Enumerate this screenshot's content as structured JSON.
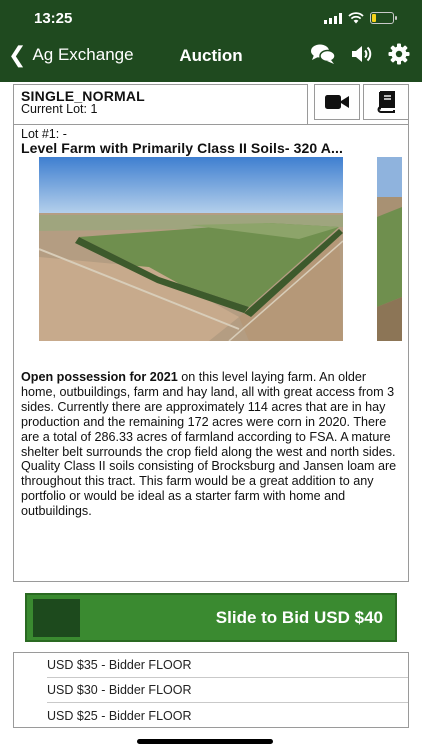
{
  "status_bar": {
    "time": "13:25"
  },
  "nav": {
    "back_label": "Ag Exchange",
    "title": "Auction",
    "icons": [
      "chat-bubbles-icon",
      "speaker-icon",
      "gear-icon"
    ],
    "color": "#1f4a1f"
  },
  "auction": {
    "type_label": "SINGLE_NORMAL",
    "current_lot": "Current Lot: 1",
    "buttons": [
      "video-camera-icon",
      "catalog-book-icon"
    ]
  },
  "lot": {
    "number": "Lot #1: -",
    "title": "Level Farm with Primarily Class II Soils- 320 A...",
    "description_lead": "Open possession for 2021",
    "description_body": " on this level laying farm. An older home, outbuildings, farm and hay land, all with great access from 3 sides. Currently there are approximately 114 acres that are in hay production and the remaining 172 acres were corn in 2020. There are a total of 286.33 acres of farmland according to FSA. A mature shelter belt surrounds the crop field along the west and north sides. Quality Class II soils consisting of Brocksburg and Jansen loam are throughout this tract. This farm would be a great addition to any portfolio or would be ideal as a starter farm with home and outbuildings."
  },
  "bid": {
    "slide_label": "Slide to Bid USD $40",
    "accent": "#3a8a30",
    "options": [
      "USD $35 - Bidder FLOOR",
      "USD $30 - Bidder FLOOR",
      "USD $25 - Bidder FLOOR"
    ]
  }
}
